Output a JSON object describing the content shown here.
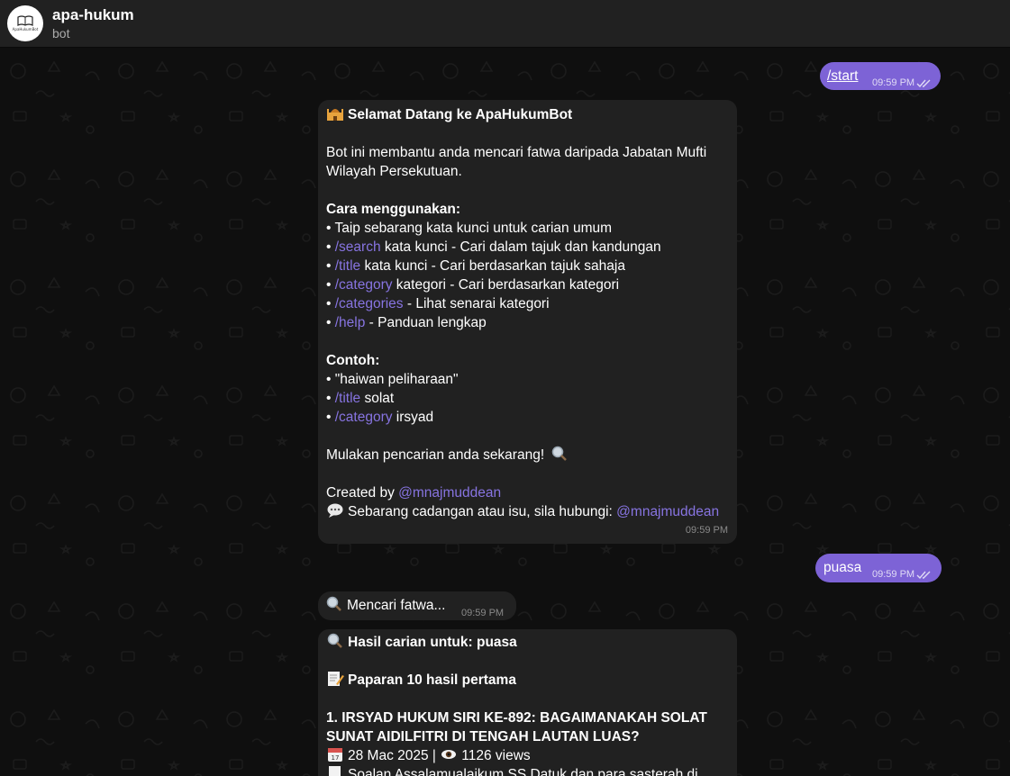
{
  "header": {
    "title": "apa-hukum",
    "subtitle": "bot",
    "avatar_text": "ApaHukumBot"
  },
  "messages": {
    "start": {
      "text": "/start",
      "time": "09:59 PM"
    },
    "welcome": {
      "title": "Selamat Datang ke ApaHukumBot",
      "intro1": "Bot ini membantu anda mencari fatwa daripada Jabatan Mufti",
      "intro2": "Wilayah Persekutuan.",
      "usage_heading": "Cara menggunakan:",
      "usage": [
        {
          "prefix": "• ",
          "cmd": "",
          "rest": "Taip sebarang kata kunci untuk carian umum"
        },
        {
          "prefix": "• ",
          "cmd": "/search",
          "rest": " kata kunci - Cari dalam tajuk dan kandungan"
        },
        {
          "prefix": "• ",
          "cmd": "/title",
          "rest": " kata kunci - Cari berdasarkan tajuk sahaja"
        },
        {
          "prefix": "• ",
          "cmd": "/category",
          "rest": " kategori - Cari berdasarkan kategori"
        },
        {
          "prefix": "• ",
          "cmd": "/categories",
          "rest": " - Lihat senarai kategori"
        },
        {
          "prefix": "• ",
          "cmd": "/help",
          "rest": " - Panduan lengkap"
        }
      ],
      "example_heading": "Contoh:",
      "examples": [
        {
          "prefix": "• ",
          "cmd": "",
          "rest": "\"haiwan peliharaan\""
        },
        {
          "prefix": "• ",
          "cmd": "/title",
          "rest": " solat"
        },
        {
          "prefix": "• ",
          "cmd": "/category",
          "rest": " irsyad"
        }
      ],
      "cta": "Mulakan pencarian anda sekarang!",
      "created_by": "Created by ",
      "created_handle": "@mnajmuddean",
      "contact": "Sebarang cadangan atau isu, sila hubungi: ",
      "contact_handle": "@mnajmuddean",
      "time": "09:59 PM"
    },
    "puasa": {
      "text": "puasa",
      "time": "09:59 PM"
    },
    "searching": {
      "text": "Mencari fatwa...",
      "time": "09:59 PM"
    },
    "results": {
      "heading": "Hasil carian untuk: puasa",
      "sub": "Paparan 10 hasil pertama",
      "item1_line1": "1. IRSYAD HUKUM SIRI KE-892: BAGAIMANAKAH SOLAT",
      "item1_line2": "SUNAT AIDILFITRI DI TENGAH LAUTAN LUAS?",
      "item1_meta": "28 Mac 2025 | ",
      "item1_views": "1126 views",
      "item1_snippet": "Soalan Assalamualaikum SS Datuk dan para sasterah di"
    }
  },
  "colors": {
    "header_bg": "#212121",
    "bubble_in": "#212121",
    "bubble_out": "#7d63d6",
    "link": "#8774e1"
  }
}
